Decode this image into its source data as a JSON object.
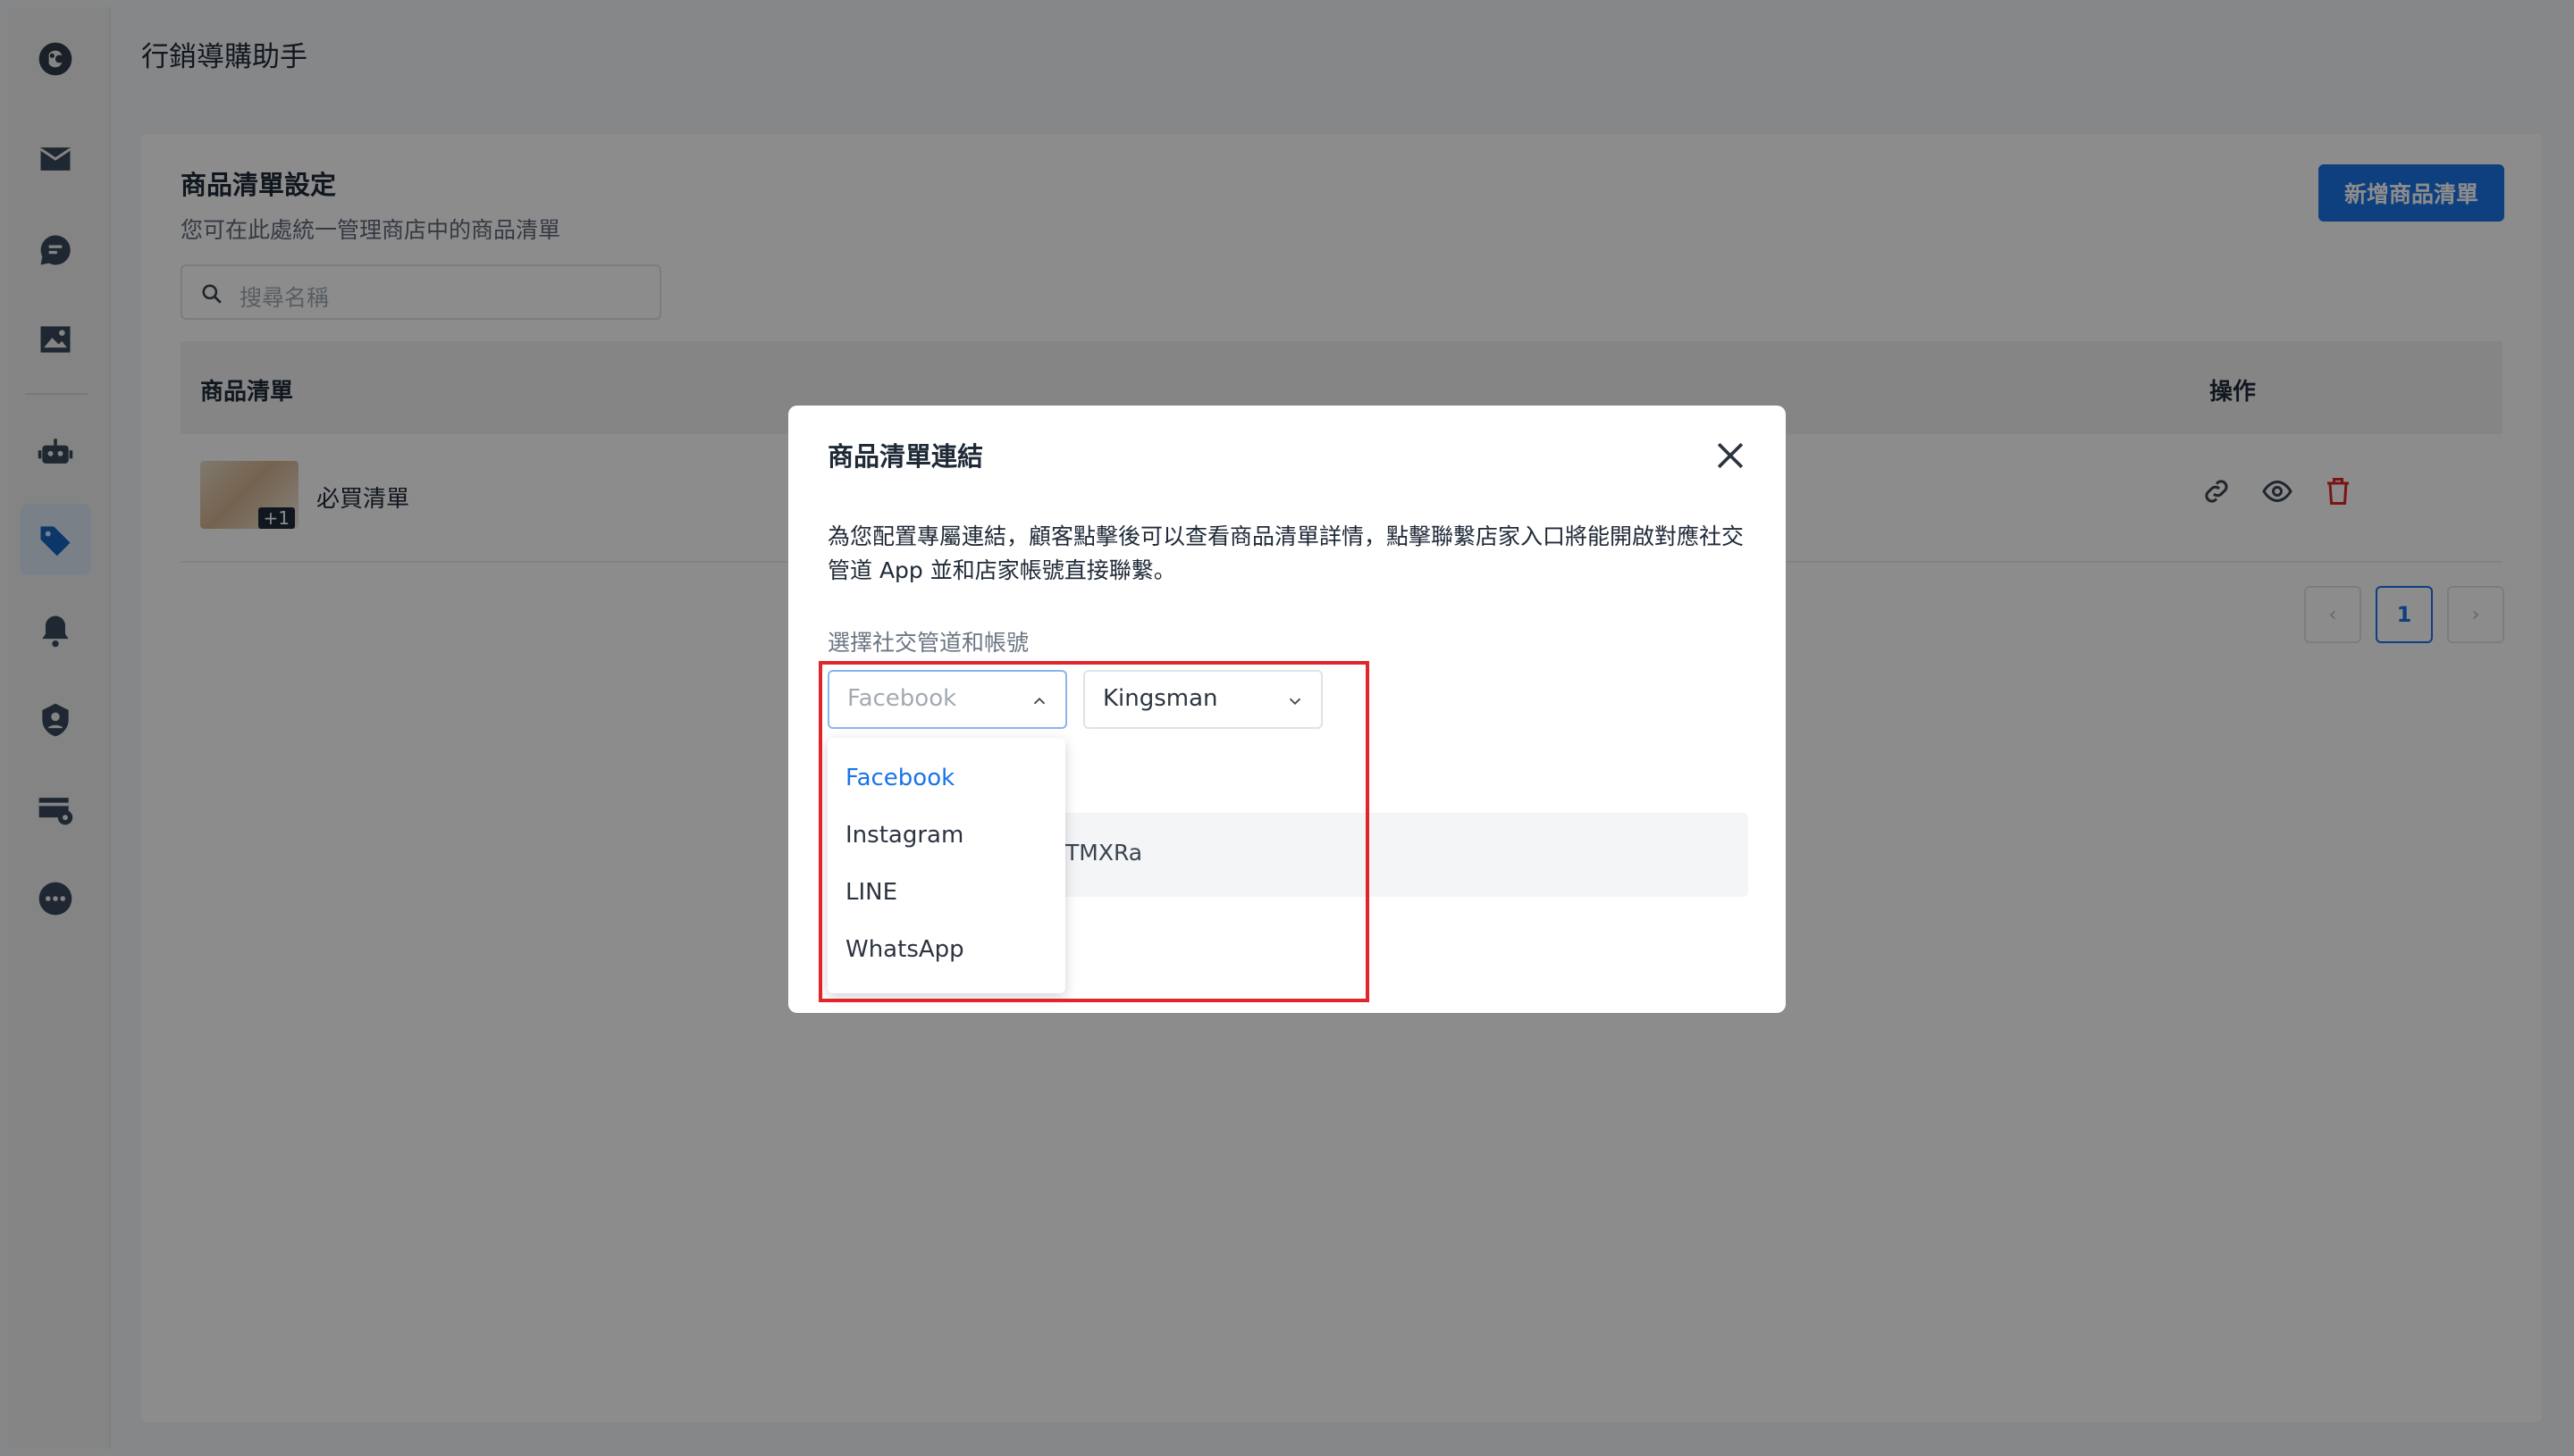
{
  "header": {
    "title": "行銷導購助手"
  },
  "sidebar": {
    "items": [
      {
        "name": "sidebar-logo",
        "icon": "logo-icon"
      },
      {
        "name": "sidebar-item-inbox",
        "icon": "mail-icon"
      },
      {
        "name": "sidebar-item-chat",
        "icon": "chat-icon"
      },
      {
        "name": "sidebar-item-media",
        "icon": "image-icon"
      },
      {
        "name": "sidebar-item-bot",
        "icon": "robot-icon"
      },
      {
        "name": "sidebar-item-product-tags",
        "icon": "tag-icon",
        "active": true
      },
      {
        "name": "sidebar-item-notifications",
        "icon": "bell-icon"
      },
      {
        "name": "sidebar-item-contacts",
        "icon": "user-badge-icon"
      },
      {
        "name": "sidebar-item-settings",
        "icon": "card-settings-icon"
      },
      {
        "name": "sidebar-item-more",
        "icon": "more-icon"
      }
    ]
  },
  "page": {
    "title": "商品清單設定",
    "subtitle": "您可在此處統一管理商店中的商品清單",
    "search_placeholder": "搜尋名稱",
    "add_button": "新增商品清單"
  },
  "table": {
    "columns": [
      "商品清單",
      "操作"
    ],
    "rows": [
      {
        "name": "必買清單",
        "thumb_badge": "+1"
      }
    ]
  },
  "pagination": {
    "prev": "‹",
    "current": "1",
    "next": "›"
  },
  "modal": {
    "title": "商品清單連結",
    "description": "為您配置專屬連結，顧客點擊後可以查看商品清單詳情，點擊聯繫店家入口將能開啟對應社交管道 App 並和店家帳號直接聯繫。",
    "channel_label": "選擇社交管道和帳號",
    "channel_select": {
      "placeholder": "Facebook",
      "open": true
    },
    "account_select": {
      "value": "Kingsman"
    },
    "link_partial": "TMXRa",
    "channel_options": [
      "Facebook",
      "Instagram",
      "LINE",
      "WhatsApp"
    ],
    "selected_option": "Facebook"
  },
  "colors": {
    "accent": "#1a73e8",
    "danger": "#e0262b",
    "annotation_box": "#e0262b"
  }
}
